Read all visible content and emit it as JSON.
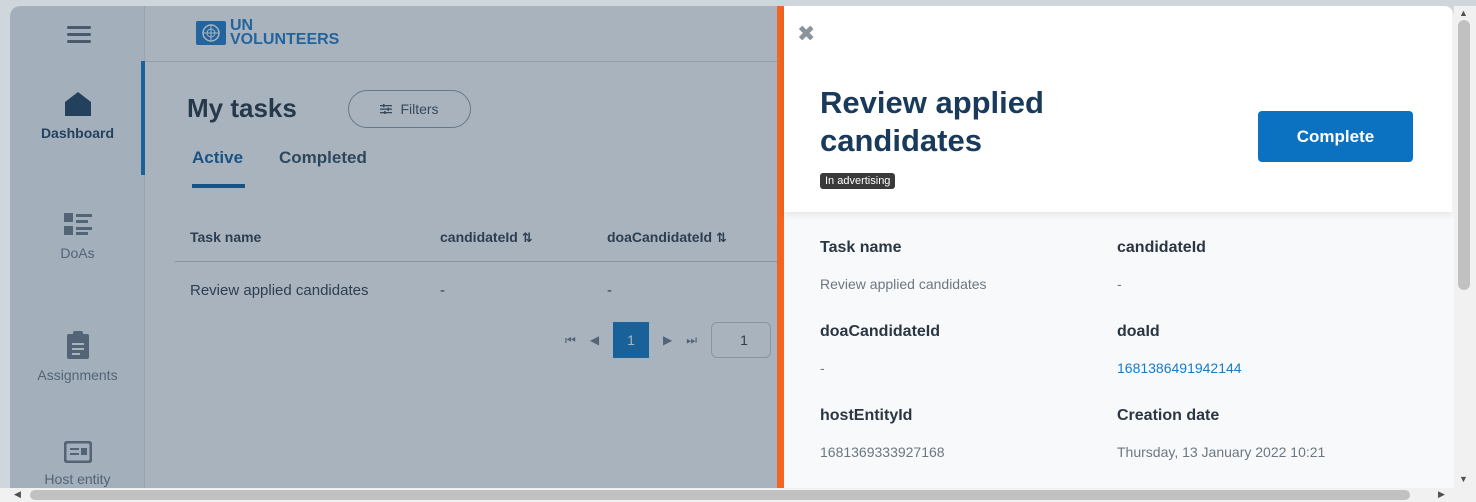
{
  "sidebar": {
    "items": [
      {
        "label": "Dashboard",
        "icon": "home-icon"
      },
      {
        "label": "DoAs",
        "icon": "list-icon"
      },
      {
        "label": "Assignments",
        "icon": "clipboard-icon"
      },
      {
        "label": "Host entity",
        "icon": "id-card-icon"
      }
    ]
  },
  "header": {
    "logo_line1": "UN",
    "logo_line2": "VOLUNTEERS"
  },
  "main": {
    "title": "My tasks",
    "filters_label": "Filters",
    "tabs": [
      {
        "label": "Active"
      },
      {
        "label": "Completed"
      }
    ],
    "table": {
      "columns": [
        "Task name",
        "candidateId",
        "doaCandidateId"
      ],
      "rows": [
        [
          "Review applied candidates",
          "-",
          "-"
        ]
      ]
    },
    "pagination": {
      "current_page": "1",
      "page_size": "1"
    }
  },
  "drawer": {
    "title": "Review applied candidates",
    "status": "In advertising",
    "complete_label": "Complete",
    "fields": [
      {
        "label": "Task name",
        "value": "Review applied candidates"
      },
      {
        "label": "candidateId",
        "value": "-"
      },
      {
        "label": "doaCandidateId",
        "value": "-"
      },
      {
        "label": "doaId",
        "value": "1681386491942144"
      },
      {
        "label": "hostEntityId",
        "value": "1681369333927168"
      },
      {
        "label": "Creation date",
        "value": "Thursday, 13 January 2022 10:21"
      }
    ]
  },
  "colors": {
    "accent": "#0a72c0",
    "drawer_accent": "#f26522",
    "title": "#1a3a5c"
  }
}
